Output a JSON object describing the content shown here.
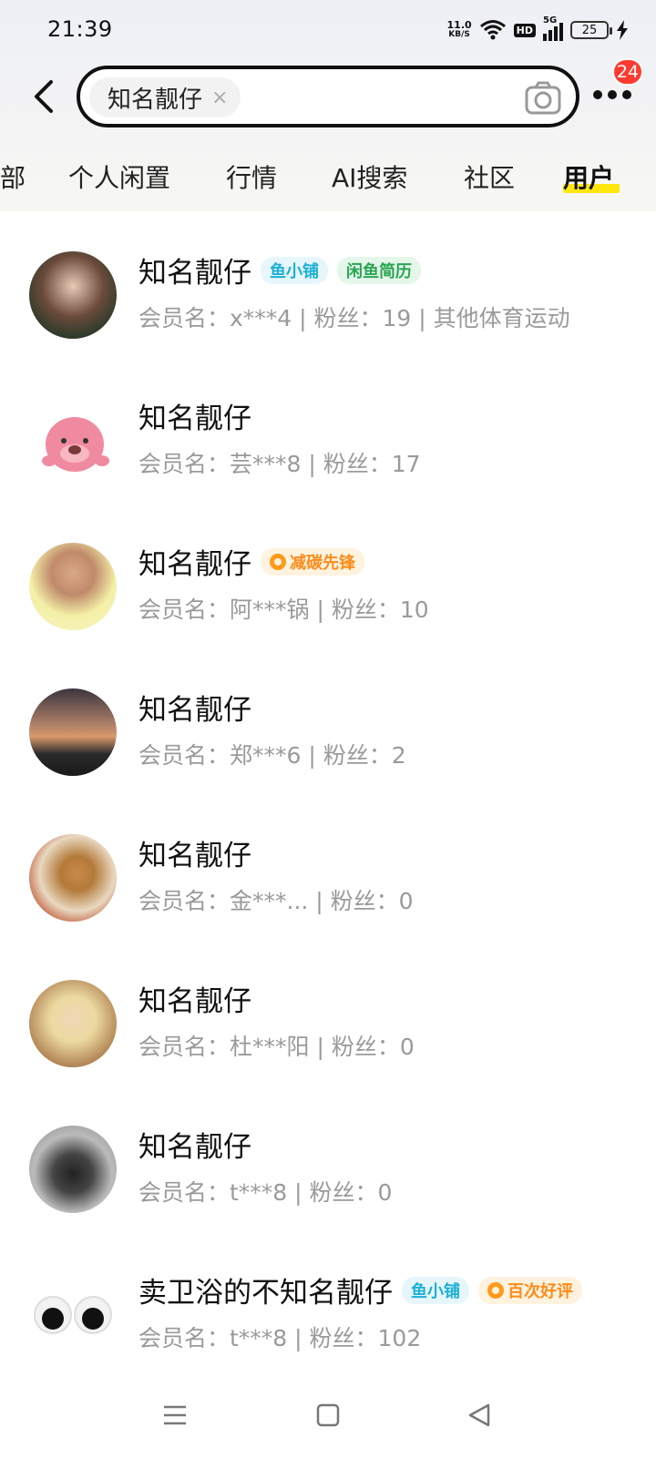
{
  "status_bar": {
    "time": "21:39",
    "net_speed_value": "11.0",
    "net_speed_unit": "KB/S",
    "hd": "HD",
    "signal": "5G",
    "battery": "25"
  },
  "search": {
    "query": "知名靓仔",
    "clear_icon": "×"
  },
  "more_badge": "24",
  "tabs": [
    {
      "label": "部"
    },
    {
      "label": "个人闲置"
    },
    {
      "label": "行情"
    },
    {
      "label": "AI搜索"
    },
    {
      "label": "社区"
    },
    {
      "label": "用户",
      "active": true
    }
  ],
  "users": [
    {
      "name": "知名靓仔",
      "meta": "会员名：x***4 | 粉丝：19 | 其他体育运动",
      "badges": [
        "鱼小铺",
        "闲鱼简历"
      ]
    },
    {
      "name": "知名靓仔",
      "meta": "会员名：芸***8 | 粉丝：17",
      "badges": []
    },
    {
      "name": "知名靓仔",
      "meta": "会员名：阿***锅 | 粉丝：10",
      "badges": [
        "减碳先锋"
      ]
    },
    {
      "name": "知名靓仔",
      "meta": "会员名：郑***6 | 粉丝：2",
      "badges": []
    },
    {
      "name": "知名靓仔",
      "meta": "会员名：金***... | 粉丝：0",
      "badges": []
    },
    {
      "name": "知名靓仔",
      "meta": "会员名：杜***阳 | 粉丝：0",
      "badges": []
    },
    {
      "name": "知名靓仔",
      "meta": "会员名：t***8 | 粉丝：0",
      "badges": []
    },
    {
      "name": "卖卫浴的不知名靓仔",
      "meta": "会员名：t***8 | 粉丝：102",
      "badges": [
        "鱼小铺",
        "百次好评"
      ]
    }
  ],
  "colors": {
    "accent_yellow": "#ffe60f",
    "badge_red": "#ff3b30",
    "meta_gray": "#9a9a9a"
  }
}
